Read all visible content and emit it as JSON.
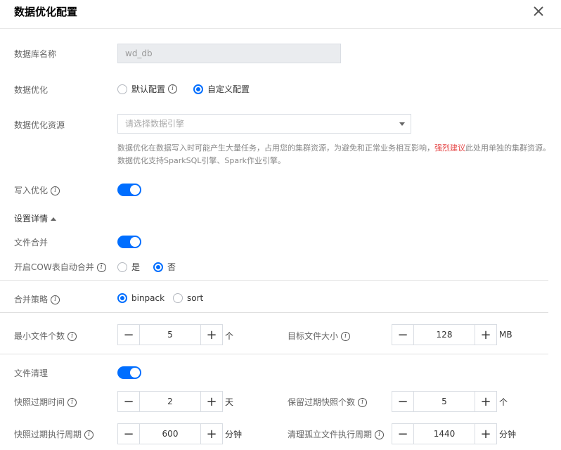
{
  "dialog": {
    "title": "数据优化配置"
  },
  "form": {
    "db_name": {
      "label": "数据库名称",
      "value": "wd_db"
    },
    "optimize": {
      "label": "数据优化",
      "options": [
        "默认配置",
        "自定义配置"
      ],
      "selected": "自定义配置"
    },
    "resource": {
      "label": "数据优化资源",
      "placeholder": "请选择数据引擎",
      "help_a": "数据优化在数据写入时可能产生大量任务，占用您的集群资源，为避免和正常业务相互影响，",
      "help_warn": "强烈建议",
      "help_b": "此处用单独的集群资源。数据优化支持SparkSQL引擎、Spark作业引擎。"
    },
    "write_opt": {
      "label": "写入优化",
      "enabled": true
    },
    "settings_title": "设置详情",
    "file_merge": {
      "label": "文件合并",
      "enabled": true
    },
    "cow_merge": {
      "label": "开启COW表自动合并",
      "options": [
        "是",
        "否"
      ],
      "selected": "否"
    },
    "merge_strategy": {
      "label": "合并策略",
      "options": [
        "binpack",
        "sort"
      ],
      "selected": "binpack"
    },
    "min_files": {
      "label": "最小文件个数",
      "value": "5",
      "unit": "个"
    },
    "target_size": {
      "label": "目标文件大小",
      "value": "128",
      "unit": "MB"
    },
    "file_cleanup": {
      "label": "文件清理",
      "enabled": true
    },
    "snapshot_expire": {
      "label": "快照过期时间",
      "value": "2",
      "unit": "天"
    },
    "keep_snapshots": {
      "label": "保留过期快照个数",
      "value": "5",
      "unit": "个"
    },
    "snapshot_period": {
      "label": "快照过期执行周期",
      "value": "600",
      "unit": "分钟"
    },
    "orphan_period": {
      "label": "清理孤立文件执行周期",
      "value": "1440",
      "unit": "分钟"
    }
  },
  "icons": {
    "close": "close-icon",
    "info": "info-icon",
    "caret": "chevron-down-icon",
    "collapse": "caret-up-icon"
  },
  "colors": {
    "accent": "#006eff",
    "warn": "#e54545"
  }
}
